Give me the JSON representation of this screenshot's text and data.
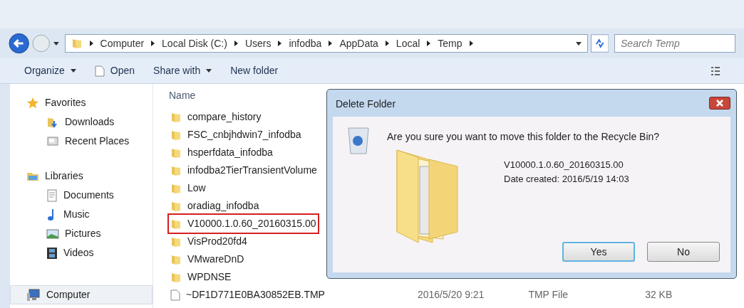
{
  "address_bar": {
    "path": [
      "Computer",
      "Local Disk (C:)",
      "Users",
      "infodba",
      "AppData",
      "Local",
      "Temp"
    ],
    "search_placeholder": "Search Temp"
  },
  "toolbar": [
    {
      "label": "Organize",
      "kind": "menu"
    },
    {
      "label": "Open",
      "kind": "file"
    },
    {
      "label": "Share with",
      "kind": "menu"
    },
    {
      "label": "New folder",
      "kind": "plain"
    }
  ],
  "sidebar": {
    "groups": [
      {
        "label": "Favorites",
        "selected": false,
        "items": [
          {
            "label": "Downloads",
            "selected": false
          },
          {
            "label": "Recent Places",
            "selected": false
          }
        ]
      },
      {
        "label": "Libraries",
        "selected": false,
        "items": [
          {
            "label": "Documents",
            "selected": false
          },
          {
            "label": "Music",
            "selected": false
          },
          {
            "label": "Pictures",
            "selected": false
          },
          {
            "label": "Videos",
            "selected": false
          }
        ]
      },
      {
        "label": "Computer",
        "selected": true
      }
    ]
  },
  "file_list": {
    "column": "Name",
    "rows": [
      {
        "name": "compare_history",
        "kind": "folder",
        "selected": false
      },
      {
        "name": "FSC_cnbjhdwin7_infodba",
        "kind": "folder",
        "selected": false
      },
      {
        "name": "hsperfdata_infodba",
        "kind": "folder",
        "selected": false
      },
      {
        "name": "infodba2TierTransientVolume",
        "kind": "folder",
        "selected": false
      },
      {
        "name": "Low",
        "kind": "folder",
        "selected": false
      },
      {
        "name": "oradiag_infodba",
        "kind": "folder",
        "selected": false
      },
      {
        "name": "V10000.1.0.60_20160315.00",
        "kind": "folder",
        "selected": true
      },
      {
        "name": "VisProd20fd4",
        "kind": "folder",
        "selected": false
      },
      {
        "name": "VMwareDnD",
        "kind": "folder",
        "selected": false
      },
      {
        "name": "WPDNSE",
        "kind": "folder",
        "selected": false
      },
      {
        "name": "~DF1D771E0BA30852EB.TMP",
        "kind": "file",
        "selected": false,
        "date": "2016/5/20 9:21",
        "type": "TMP File",
        "size": "32 KB"
      }
    ]
  },
  "dialog": {
    "title": "Delete Folder",
    "question": "Are you sure you want to move this folder to the Recycle Bin?",
    "item_name": "V10000.1.0.60_20160315.00",
    "item_date": "Date created: 2016/5/19 14:03",
    "buttons": [
      {
        "label": "Yes",
        "default": true
      },
      {
        "label": "No",
        "default": false
      }
    ]
  }
}
